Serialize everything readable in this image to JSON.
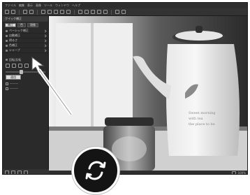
{
  "menubar": {
    "items": [
      "ファイル",
      "編集",
      "表示",
      "画像",
      "ツール",
      "ウィンドウ",
      "ヘルプ"
    ]
  },
  "sidebar": {
    "header": "クイック補正",
    "tabs": [
      "補正",
      "色",
      "現像"
    ],
    "rows": [
      "ベーシック補正",
      "自動補正",
      "明るさ",
      "色補正",
      "シャープ"
    ],
    "section_label": "回転/反転",
    "apply_label": "適用"
  },
  "status": {
    "text": "100%"
  },
  "photo": {
    "pot_text": [
      "Sweet morning",
      "with tea",
      "the place to be"
    ]
  },
  "colors": {
    "ui_dark": "#262626",
    "accent_white": "#ffffff"
  },
  "icons": [
    "rotate-icon",
    "arrow-icon"
  ]
}
